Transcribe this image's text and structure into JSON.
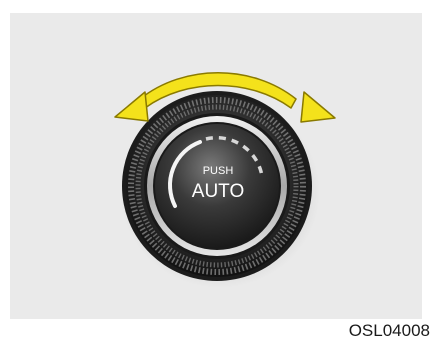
{
  "knob": {
    "push_label": "PUSH",
    "mode_label": "AUTO"
  },
  "figure_code": "OSL04008",
  "colors": {
    "panel": "#eaeaea",
    "arrow_fill": "#f4e21b",
    "arrow_outline": "#8a7a00",
    "knob_face": "#333333"
  },
  "icons": {
    "rotation": "double-headed-curved-arrow-icon"
  }
}
